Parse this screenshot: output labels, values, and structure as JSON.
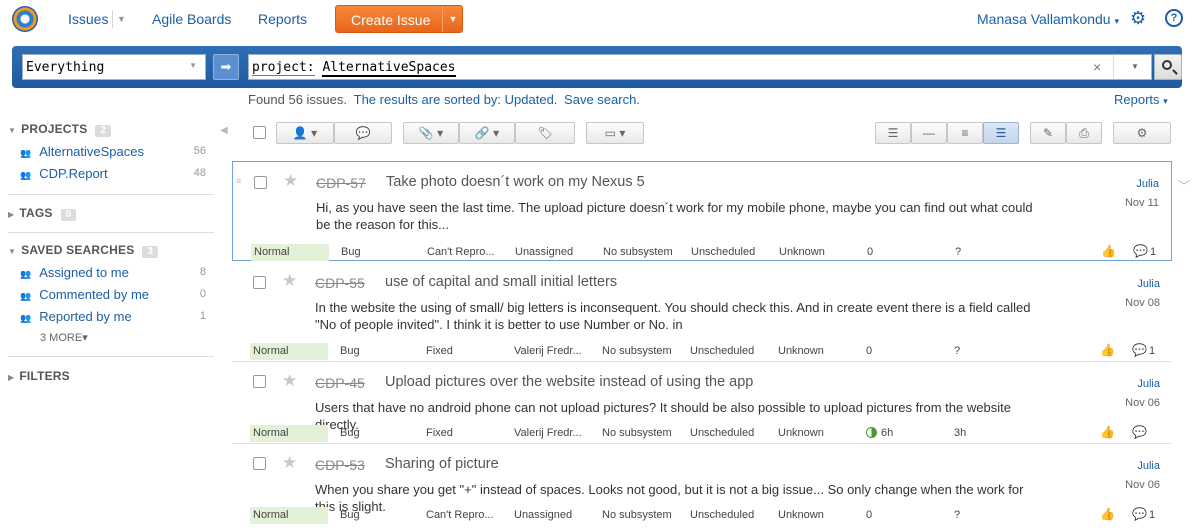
{
  "nav": {
    "issues": "Issues",
    "agile_boards": "Agile Boards",
    "reports": "Reports",
    "create_issue": "Create Issue",
    "user": "Manasa Vallamkondu"
  },
  "search": {
    "context": "Everything",
    "query_key": "project:",
    "query_value": "AlternativeSpaces"
  },
  "results": {
    "found": "Found 56 issues.",
    "sorted": "The results are sorted by: Updated.",
    "save": "Save search.",
    "reports_link": "Reports"
  },
  "sidebar": {
    "projects": {
      "title": "PROJECTS",
      "count": "2",
      "items": [
        {
          "label": "AlternativeSpaces",
          "count": "56"
        },
        {
          "label": "CDP.Report",
          "count": "48"
        }
      ]
    },
    "tags": {
      "title": "TAGS",
      "count": "0"
    },
    "saved_searches": {
      "title": "SAVED SEARCHES",
      "count": "3",
      "items": [
        {
          "label": "Assigned to me",
          "count": "8"
        },
        {
          "label": "Commented by me",
          "count": "0"
        },
        {
          "label": "Reported by me",
          "count": "1"
        }
      ],
      "more": "3 MORE"
    },
    "filters": {
      "title": "FILTERS"
    }
  },
  "issues": [
    {
      "id": "CDP-57",
      "summary": "Take photo doesn´t work on my Nexus 5",
      "description": "Hi, as you have seen the last time. The upload picture doesn´t work for my mobile phone, maybe you can find out what could be the reason for this...",
      "assignee_short": "Julia",
      "date": "Nov 11",
      "priority": "Normal",
      "type": "Bug",
      "state": "Can't Repro...",
      "assignee": "Unassigned",
      "subsystem": "No subsystem",
      "fix_version": "Unscheduled",
      "severity": "Unknown",
      "spent": "0",
      "estimate": "?",
      "comments": "1"
    },
    {
      "id": "CDP-55",
      "summary": "use of capital and small initial letters",
      "description": "In the website the using of small/ big letters is inconsequent. You should check this. And in create event there is a field called \"No of people invited\". I think it is better to use Number or No. in",
      "assignee_short": "Julia",
      "date": "Nov 08",
      "priority": "Normal",
      "type": "Bug",
      "state": "Fixed",
      "assignee": "Valerij Fredr...",
      "subsystem": "No subsystem",
      "fix_version": "Unscheduled",
      "severity": "Unknown",
      "spent": "0",
      "estimate": "?",
      "comments": "1"
    },
    {
      "id": "CDP-45",
      "summary": "Upload pictures over the website instead of using the app",
      "description": "Users that have no android phone can not upload pictures? It should be also possible to upload pictures from the website directly.",
      "assignee_short": "Julia",
      "date": "Nov 06",
      "priority": "Normal",
      "type": "Bug",
      "state": "Fixed",
      "assignee": "Valerij Fredr...",
      "subsystem": "No subsystem",
      "fix_version": "Unscheduled",
      "severity": "Unknown",
      "spent": "6h",
      "estimate": "3h",
      "comments": ""
    },
    {
      "id": "CDP-53",
      "summary": "Sharing of picture",
      "description": "When you share you get \"+\" instead of spaces. Looks not good, but it is not a big issue... So only change when the work for this is slight.",
      "assignee_short": "Julia",
      "date": "Nov 06",
      "priority": "Normal",
      "type": "Bug",
      "state": "Can't Repro...",
      "assignee": "Unassigned",
      "subsystem": "No subsystem",
      "fix_version": "Unscheduled",
      "severity": "Unknown",
      "spent": "0",
      "estimate": "?",
      "comments": "1"
    }
  ],
  "colors": {
    "accent": "#1a5fa6",
    "create": "#f07a2a",
    "priority_normal": "#e4f1d9"
  }
}
